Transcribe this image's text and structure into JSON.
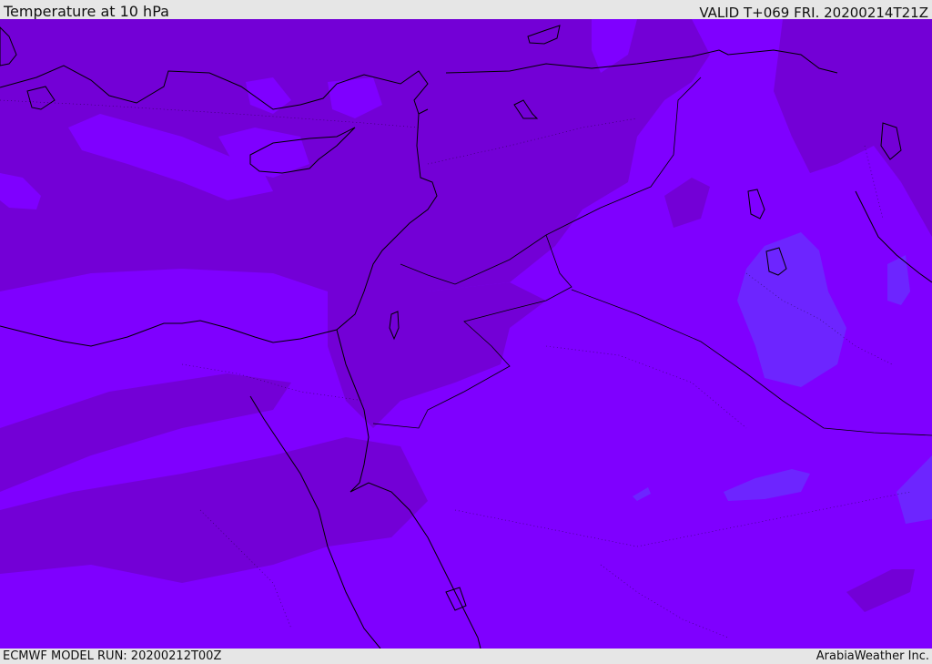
{
  "header": {
    "title": "Temperature at 10 hPa",
    "valid": "VALID T+069 FRI. 20200214T21Z"
  },
  "footer": {
    "model_run": "ECMWF MODEL RUN: 20200212T00Z",
    "credit": "ArabiaWeather Inc."
  },
  "map": {
    "field": "Temperature at 10 hPa",
    "colors": {
      "base": "#7f00ff",
      "warmer": "#7300d6",
      "cooler": "#6a2bff",
      "coast": "#000000"
    }
  }
}
